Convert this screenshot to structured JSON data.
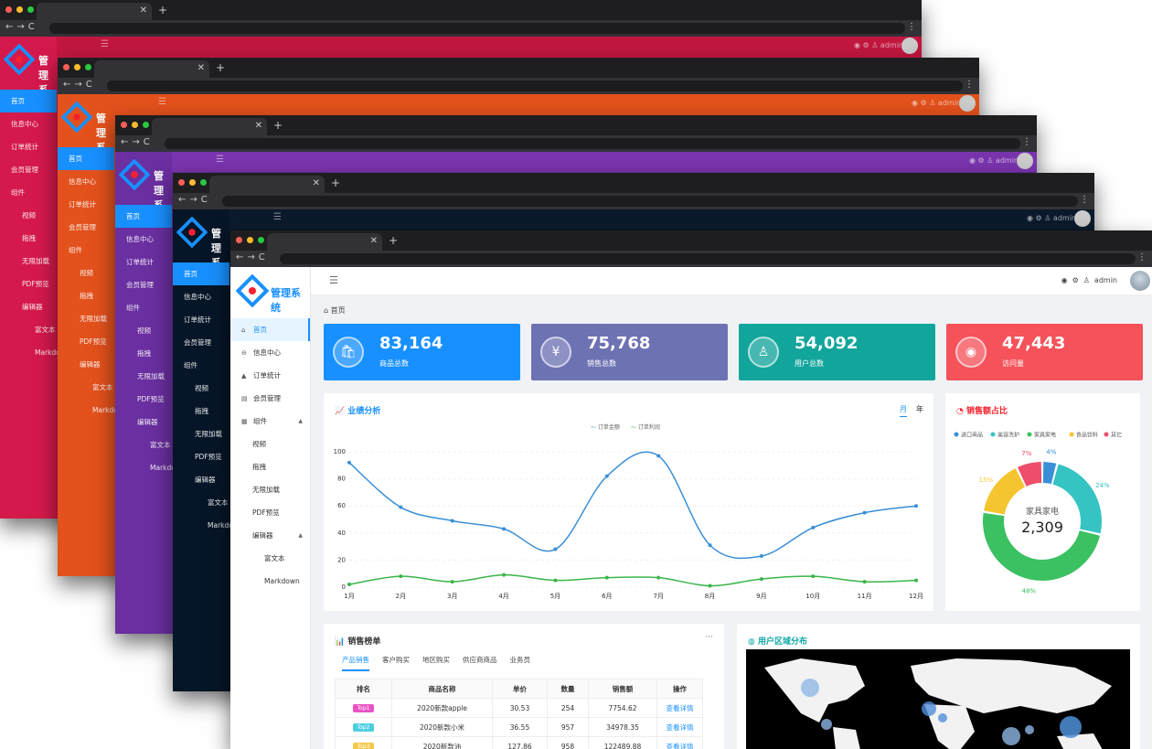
{
  "app_title": "管理系统",
  "user": "admin",
  "themes": [
    {
      "sidebar": "#d5194c",
      "header": "#c2173f"
    },
    {
      "sidebar": "#e3511c",
      "header": "#e3511c"
    },
    {
      "sidebar": "#6a2fa0",
      "header": "#7a35ae"
    },
    {
      "sidebar": "#061527",
      "header": "#0b1a2c"
    }
  ],
  "menu": [
    {
      "label": "首页",
      "icon": "home-icon",
      "level": 0,
      "active": true
    },
    {
      "label": "信息中心",
      "icon": "info-icon",
      "level": 0
    },
    {
      "label": "订单统计",
      "icon": "warning-icon",
      "level": 0
    },
    {
      "label": "会员管理",
      "icon": "card-icon",
      "level": 0
    },
    {
      "label": "组件",
      "icon": "grid-icon",
      "level": 0,
      "expanded": true
    },
    {
      "label": "视频",
      "level": 1
    },
    {
      "label": "拖拽",
      "level": 1
    },
    {
      "label": "无限加载",
      "level": 1
    },
    {
      "label": "PDF预览",
      "level": 1
    },
    {
      "label": "编辑器",
      "level": 1,
      "expanded": true
    },
    {
      "label": "富文本",
      "level": 2
    },
    {
      "label": "Markdown",
      "level": 2
    }
  ],
  "breadcrumb": "首页",
  "stats": [
    {
      "value": "83,164",
      "label": "商品总数",
      "color": "#1890ff",
      "icon": "bag-icon"
    },
    {
      "value": "75,768",
      "label": "销售总数",
      "color": "#6d72b3",
      "icon": "yen-icon"
    },
    {
      "value": "54,092",
      "label": "用户总数",
      "color": "#12a59c",
      "icon": "user-icon"
    },
    {
      "value": "47,443",
      "label": "访问量",
      "color": "#f5525a",
      "icon": "eye-icon"
    }
  ],
  "performance": {
    "title": "业绩分析",
    "toggle_month": "月",
    "toggle_year": "年",
    "legend": [
      "订单金额",
      "订单利润"
    ]
  },
  "share": {
    "title": "销售额占比",
    "center_label": "家具家电",
    "center_value": "2,309"
  },
  "ranking": {
    "title": "销售榜单",
    "more": "···",
    "tabs": [
      "产品销售",
      "客户购买",
      "地区购买",
      "供应商商品",
      "业务员"
    ],
    "headers": [
      "排名",
      "商品名称",
      "单价",
      "数量",
      "销售额",
      "操作"
    ],
    "rows": [
      {
        "rank": "Top1",
        "name": "2020新款apple",
        "price": "30.53",
        "qty": "254",
        "sales": "7754.62",
        "action": "查看详情",
        "color": "#eb52c5"
      },
      {
        "rank": "Top2",
        "name": "2020新款小米",
        "price": "36.55",
        "qty": "957",
        "sales": "34978.35",
        "action": "查看详情",
        "color": "#4ccfe0"
      },
      {
        "rank": "Top3",
        "name": "2020新款油",
        "price": "127.86",
        "qty": "958",
        "sales": "122489.88",
        "action": "查看详情",
        "color": "#f2c94c"
      }
    ]
  },
  "region": {
    "title": "用户区域分布"
  },
  "chart_data": [
    {
      "type": "line",
      "x": [
        "1月",
        "2月",
        "3月",
        "4月",
        "5月",
        "6月",
        "7月",
        "8月",
        "9月",
        "10月",
        "11月",
        "12月"
      ],
      "ylim": [
        0,
        100
      ],
      "yticks": [
        0,
        20,
        40,
        60,
        80,
        100
      ],
      "series": [
        {
          "name": "订单金额",
          "color": "#3a8fd8",
          "values": [
            92,
            59,
            49,
            43,
            28,
            82,
            97,
            31,
            23,
            44,
            55,
            60
          ]
        },
        {
          "name": "订单利润",
          "color": "#3bb54a",
          "values": [
            2,
            8,
            4,
            9,
            5,
            7,
            7,
            1,
            6,
            8,
            4,
            5
          ]
        }
      ]
    },
    {
      "type": "pie",
      "labels": [
        "进口商品",
        "美容洗护",
        "家具家电",
        "食品饮料",
        "其它"
      ],
      "colors": [
        "#3a8fd8",
        "#36c3c3",
        "#3bc162",
        "#f5c530",
        "#ee4e6a"
      ],
      "values": [
        4,
        24,
        48,
        15,
        7
      ],
      "value_labels": [
        "4%",
        "24%",
        "48%",
        "15%",
        "7%"
      ]
    }
  ]
}
